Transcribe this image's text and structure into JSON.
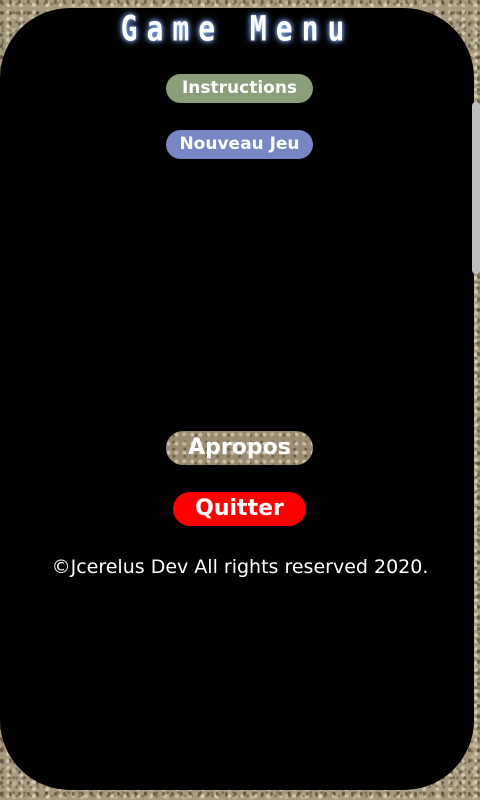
{
  "menu": {
    "title": "Game Menu",
    "buttons": {
      "instructions": "Instructions",
      "new_game": "Nouveau Jeu",
      "about": "Apropos",
      "quit": "Quitter"
    },
    "copyright": "©Jcerelus Dev All rights reserved 2020."
  },
  "colors": {
    "panel_background": "#000000",
    "instructions_button": "#8a9e7a",
    "new_game_button": "#7687c4",
    "quit_button": "#ff0000",
    "text": "#ffffff"
  }
}
